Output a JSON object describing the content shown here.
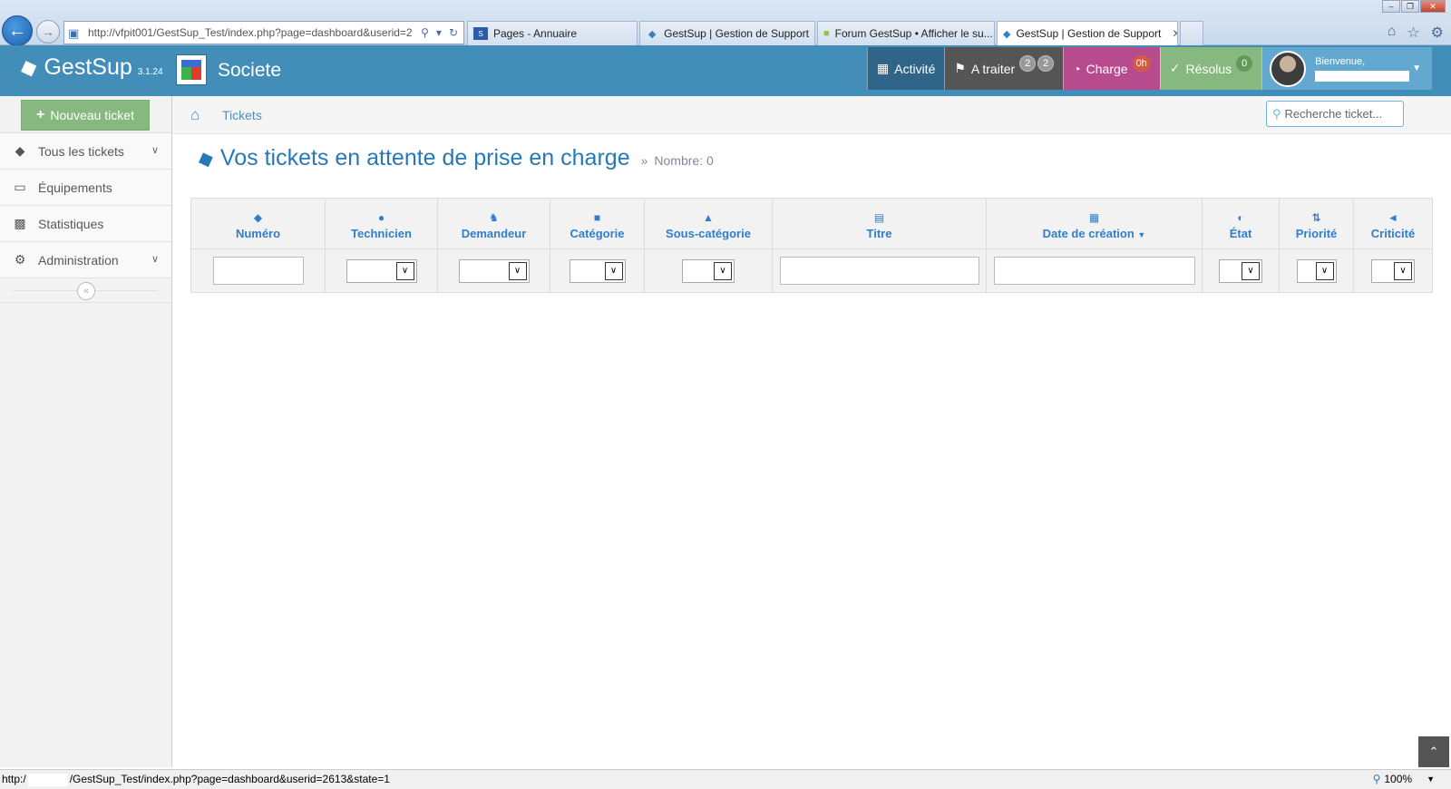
{
  "browser": {
    "address_url": "http://vfpit001/GestSup_Test/index.php?page=dashboard&userid=2",
    "tabs": [
      {
        "label": "Pages - Annuaire",
        "active": false
      },
      {
        "label": "GestSup | Gestion de Support",
        "active": false
      },
      {
        "label": "Forum GestSup • Afficher le su...",
        "active": false
      },
      {
        "label": "GestSup | Gestion de Support",
        "active": true
      }
    ],
    "status_url_prefix": "http:/",
    "status_url_suffix": "/GestSup_Test/index.php?page=dashboard&userid=2613&state=1",
    "zoom": "100%"
  },
  "app": {
    "brand": "GestSup",
    "version": "3.1.24",
    "company": "Societe",
    "nav": {
      "activite": "Activité",
      "a_traiter": "A traiter",
      "a_traiter_badge1": "2",
      "a_traiter_badge2": "2",
      "charge": "Charge",
      "charge_badge": "0h",
      "resolus": "Résolus",
      "resolus_badge": "0"
    },
    "user": {
      "greeting": "Bienvenue,"
    }
  },
  "sidebar": {
    "new_ticket": "Nouveau ticket",
    "items": [
      {
        "label": "Tous les tickets",
        "icon": "tags-icon",
        "has_submenu": true
      },
      {
        "label": "Équipements",
        "icon": "desktop-icon",
        "has_submenu": false
      },
      {
        "label": "Statistiques",
        "icon": "bar-chart-icon",
        "has_submenu": false
      },
      {
        "label": "Administration",
        "icon": "cogs-icon",
        "has_submenu": true
      }
    ]
  },
  "breadcrumb": {
    "current": "Tickets"
  },
  "search": {
    "placeholder": "Recherche ticket..."
  },
  "main": {
    "title": "Vos tickets en attente de prise en charge",
    "count_label": "Nombre: 0",
    "columns": [
      {
        "label": "Numéro",
        "icon": "tag-icon"
      },
      {
        "label": "Technicien",
        "icon": "user-icon"
      },
      {
        "label": "Demandeur",
        "icon": "male-icon"
      },
      {
        "label": "Catégorie",
        "icon": "square-icon"
      },
      {
        "label": "Sous-catégorie",
        "icon": "sitemap-icon"
      },
      {
        "label": "Titre",
        "icon": "file-text-icon"
      },
      {
        "label": "Date de création",
        "icon": "calendar-icon"
      },
      {
        "label": "État",
        "icon": "adjust-icon"
      },
      {
        "label": "Priorité",
        "icon": "sort-amount-icon"
      },
      {
        "label": "Criticité",
        "icon": "bullhorn-icon"
      }
    ]
  },
  "colors": {
    "header_bg": "#438eb9",
    "activite_bg": "#2e6589",
    "a_traiter_bg": "#555555",
    "charge_bg": "#b74b8d",
    "resolus_bg": "#87b87f",
    "user_bg": "#62a8d1",
    "new_ticket_bg": "#87b87f",
    "title_color": "#2679b5",
    "column_header_color": "#307ecc"
  }
}
